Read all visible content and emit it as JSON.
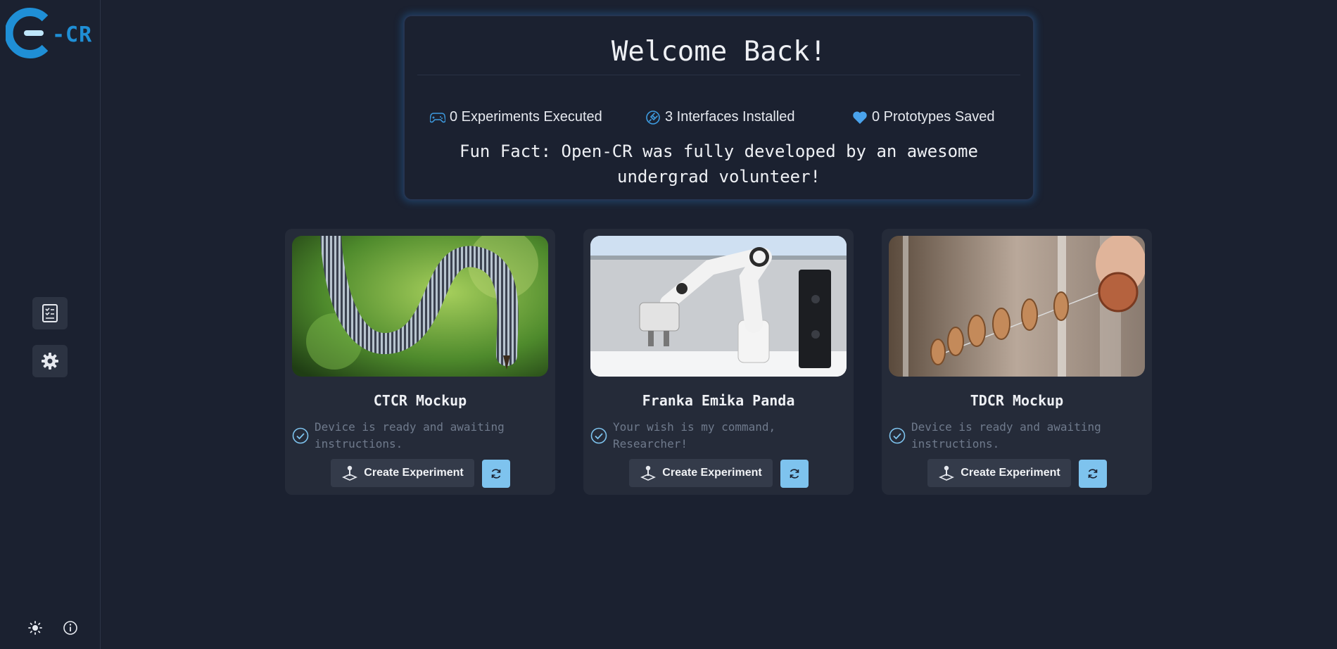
{
  "logo": {
    "text": "-CR"
  },
  "welcome": {
    "title": "Welcome Back!",
    "stats": [
      {
        "icon": "gamepad-icon",
        "label": "0 Experiments Executed"
      },
      {
        "icon": "plug-icon",
        "label": "3 Interfaces Installed"
      },
      {
        "icon": "heart-icon",
        "label": "0 Prototypes Saved"
      }
    ],
    "fun_fact": "Fun Fact: Open-CR was fully developed by an awesome undergrad volunteer!"
  },
  "devices": [
    {
      "title": "CTCR Mockup",
      "status": "Device is ready and awaiting instructions.",
      "button": "Create Experiment"
    },
    {
      "title": "Franka Emika Panda",
      "status": "Your wish is my command, Researcher!",
      "button": "Create Experiment"
    },
    {
      "title": "TDCR Mockup",
      "status": "Device is ready and awaiting instructions.",
      "button": "Create Experiment"
    }
  ],
  "colors": {
    "background": "#1b2130",
    "card": "#252b39",
    "accent": "#1f8fd6",
    "refresh_button": "#7ec3ee",
    "status_check": "#7ec3ee"
  }
}
